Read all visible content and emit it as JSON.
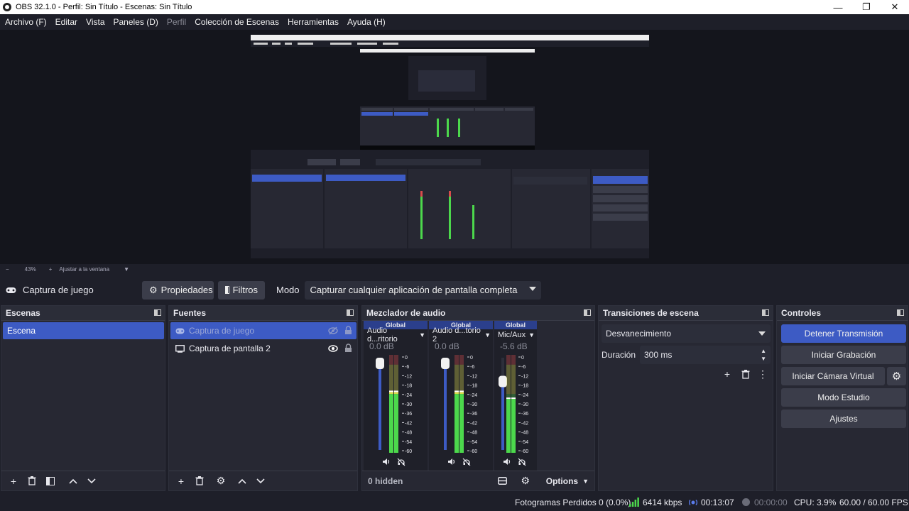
{
  "window": {
    "title": "OBS 32.1.0 - Perfil: Sin Título - Escenas: Sin Título",
    "minimize_glyph": "—",
    "maximize_glyph": "❐",
    "close_glyph": "✕"
  },
  "menu": [
    {
      "label": "Archivo (F)",
      "disabled": false
    },
    {
      "label": "Editar",
      "disabled": false
    },
    {
      "label": "Vista",
      "disabled": false
    },
    {
      "label": "Paneles (D)",
      "disabled": false
    },
    {
      "label": "Perfil",
      "disabled": true
    },
    {
      "label": "Colección de Escenas",
      "disabled": false
    },
    {
      "label": "Herramientas",
      "disabled": false
    },
    {
      "label": "Ayuda (H)",
      "disabled": false
    }
  ],
  "zoom": {
    "minus": "−",
    "value": "43%",
    "plus": "+",
    "fit_label": "Ajustar a la ventana"
  },
  "context": {
    "source_name": "Captura de juego",
    "properties_label": "Propiedades",
    "filters_label": "Filtros",
    "mode_label": "Modo",
    "mode_value": "Capturar cualquier aplicación de pantalla completa"
  },
  "scenes": {
    "title": "Escenas",
    "items": [
      "Escena"
    ]
  },
  "sources": {
    "title": "Fuentes",
    "items": [
      {
        "label": "Captura de juego",
        "icon": "gamepad-icon",
        "visible": false,
        "selected": true
      },
      {
        "label": "Captura de pantalla 2",
        "icon": "monitor-icon",
        "visible": true,
        "selected": false
      }
    ]
  },
  "mixer": {
    "title": "Mezclador de audio",
    "channels": [
      {
        "global": "Global",
        "name": "Audio d...ritorio",
        "db": "0.0 dB",
        "level": 1.0
      },
      {
        "global": "Global",
        "name": "Audio d...torio 2",
        "db": "0.0 dB",
        "level": 1.0
      },
      {
        "global": "Global",
        "name": "Mic/Aux",
        "db": "-5.6 dB",
        "level": 0.78
      }
    ],
    "scale": [
      "0",
      "-6",
      "-12",
      "-18",
      "-24",
      "-30",
      "-36",
      "-42",
      "-48",
      "-54",
      "-60"
    ],
    "hidden_label": "0 hidden",
    "options_label": "Options"
  },
  "transitions": {
    "title": "Transiciones de escena",
    "selected": "Desvanecimiento",
    "duration_label": "Duración",
    "duration_value": "300 ms"
  },
  "controls": {
    "title": "Controles",
    "stop_stream": "Detener Transmisión",
    "start_record": "Iniciar Grabación",
    "virtual_cam": "Iniciar Cámara Virtual",
    "studio_mode": "Modo Estudio",
    "settings": "Ajustes"
  },
  "status": {
    "dropped_frames": "Fotogramas Perdidos 0 (0.0%)",
    "bitrate": "6414 kbps",
    "stream_time": "00:13:07",
    "record_time": "00:00:00",
    "cpu": "CPU: 3.9%",
    "fps": "60.00 / 60.00 FPS"
  },
  "colors": {
    "accent": "#3d5bc4",
    "meter_green": "#4cd84c",
    "meter_yellow": "#d8d84c",
    "meter_red": "#d84c4c",
    "meter_dark_green": "#2c6c2c"
  }
}
